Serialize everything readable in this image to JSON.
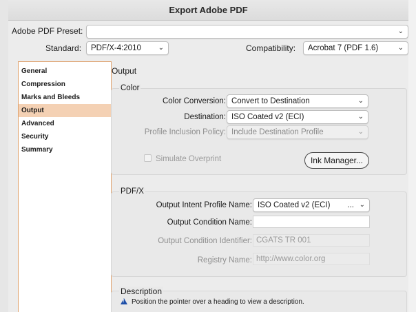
{
  "window": {
    "title": "Export Adobe PDF"
  },
  "top": {
    "preset_label": "Adobe PDF Preset:",
    "preset_value": "",
    "standard_label": "Standard:",
    "standard_value": "PDF/X-4:2010",
    "compatibility_label": "Compatibility:",
    "compatibility_value": "Acrobat 7 (PDF 1.6)"
  },
  "sidebar": {
    "items": [
      {
        "label": "General",
        "selected": false
      },
      {
        "label": "Compression",
        "selected": false
      },
      {
        "label": "Marks and Bleeds",
        "selected": false
      },
      {
        "label": "Output",
        "selected": true
      },
      {
        "label": "Advanced",
        "selected": false
      },
      {
        "label": "Security",
        "selected": false
      },
      {
        "label": "Summary",
        "selected": false
      }
    ]
  },
  "main": {
    "heading": "Output",
    "color": {
      "title": "Color",
      "conversion_label": "Color Conversion:",
      "conversion_value": "Convert to Destination",
      "destination_label": "Destination:",
      "destination_value": "ISO Coated v2 (ECI)",
      "policy_label": "Profile Inclusion Policy:",
      "policy_value": "Include Destination Profile",
      "simulate_label": "Simulate Overprint",
      "simulate_checked": false,
      "ink_manager_label": "Ink Manager..."
    },
    "pdfx": {
      "title": "PDF/X",
      "intent_label": "Output Intent Profile Name:",
      "intent_value": "ISO Coated v2 (ECI)",
      "intent_more": "...",
      "condition_name_label": "Output Condition Name:",
      "condition_name_value": "",
      "condition_id_label": "Output Condition Identifier:",
      "condition_id_value": "CGATS TR 001",
      "registry_label": "Registry Name:",
      "registry_value": "http://www.color.org"
    },
    "description": {
      "title": "Description",
      "text": "Position the pointer over a heading to view a description."
    }
  },
  "colors": {
    "sidebar_border": "#e0a26e",
    "sidebar_selected": "#f4d1b4",
    "info_icon": "#1e4fa8"
  }
}
